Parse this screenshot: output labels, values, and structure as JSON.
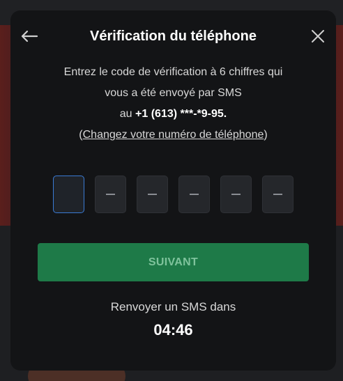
{
  "modal": {
    "title": "Vérification du téléphone",
    "back_icon": "arrow-left-icon",
    "close_icon": "close-icon"
  },
  "instructions": {
    "line1": "Entrez le code de vérification à 6 chiffres qui",
    "line2": "vous a été envoyé par SMS",
    "line3_prefix": "au ",
    "phone_number": "+1 (613) ***-*9-95.",
    "change_open": "(",
    "change_link": "Changez votre numéro de téléphone",
    "change_close": ")"
  },
  "code": {
    "digits": [
      "",
      "",
      "",
      "",
      "",
      ""
    ],
    "active_index": 0
  },
  "submit": {
    "label": "SUIVANT"
  },
  "resend": {
    "label": "Renvoyer un SMS dans",
    "timer": "04:46"
  },
  "colors": {
    "modal_bg": "#131416",
    "accent_green": "#1e7a48",
    "active_border": "#3a7bd5"
  }
}
